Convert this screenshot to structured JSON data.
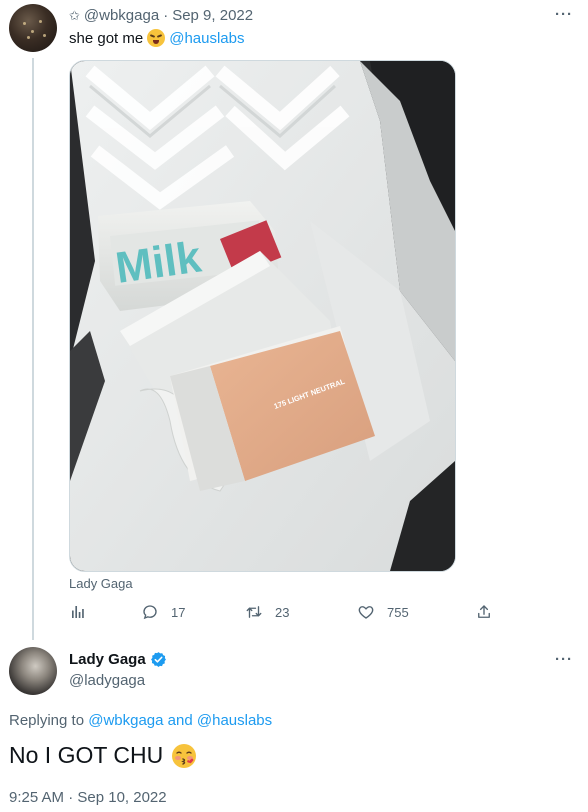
{
  "tweet": {
    "handle": "@wbkgaga",
    "separator": "·",
    "date": "Sep 9, 2022",
    "text_prefix": "she got me",
    "text_mention": "@hauslabs",
    "emoji": "face-with-steam-emoji",
    "image_caption": "Lady Gaga",
    "image_texts": {
      "box_label": "175 LIGHT NEUTRAL",
      "milk_logo": "Milk"
    },
    "stats": {
      "replies": "17",
      "retweets": "23",
      "likes": "755"
    },
    "more_label": "···"
  },
  "reply": {
    "name": "Lady Gaga",
    "handle": "@ladygaga",
    "replying_prefix": "Replying to",
    "replying_user1": "@wbkgaga",
    "replying_and": "and",
    "replying_user2": "@hauslabs",
    "text": "No I GOT CHU",
    "emoji": "kissing-face-emoji",
    "time": "9:25 AM · Sep 10, 2022",
    "more_label": "···"
  },
  "colors": {
    "accent": "#1d9bf0",
    "text_primary": "#0f1419",
    "text_secondary": "#536471",
    "divider": "#cfd9de"
  }
}
